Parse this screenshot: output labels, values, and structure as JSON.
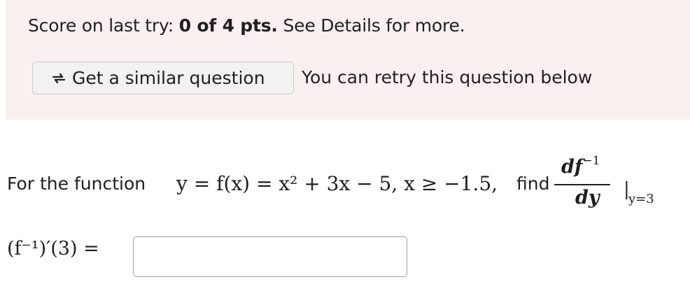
{
  "score": {
    "prefix": "Score on last try: ",
    "value": "0 of 4 pts.",
    "suffix": " See Details for more."
  },
  "similar_button": {
    "label": "Get a similar question",
    "icon": "retry-arrows-icon"
  },
  "retry_note": "You can retry this question below",
  "question": {
    "prefix": "For the function",
    "equation": "y = f(x) = x² + 3x − 5, x ≥ −1.5,",
    "find": "find",
    "derivative_numerator": "df",
    "derivative_superscript": "−1",
    "derivative_denominator": "dy",
    "evaluation_bar": "|",
    "evaluation_point": "y=3"
  },
  "answer": {
    "label": "(f⁻¹)′(3) =",
    "value": "",
    "placeholder": ""
  }
}
